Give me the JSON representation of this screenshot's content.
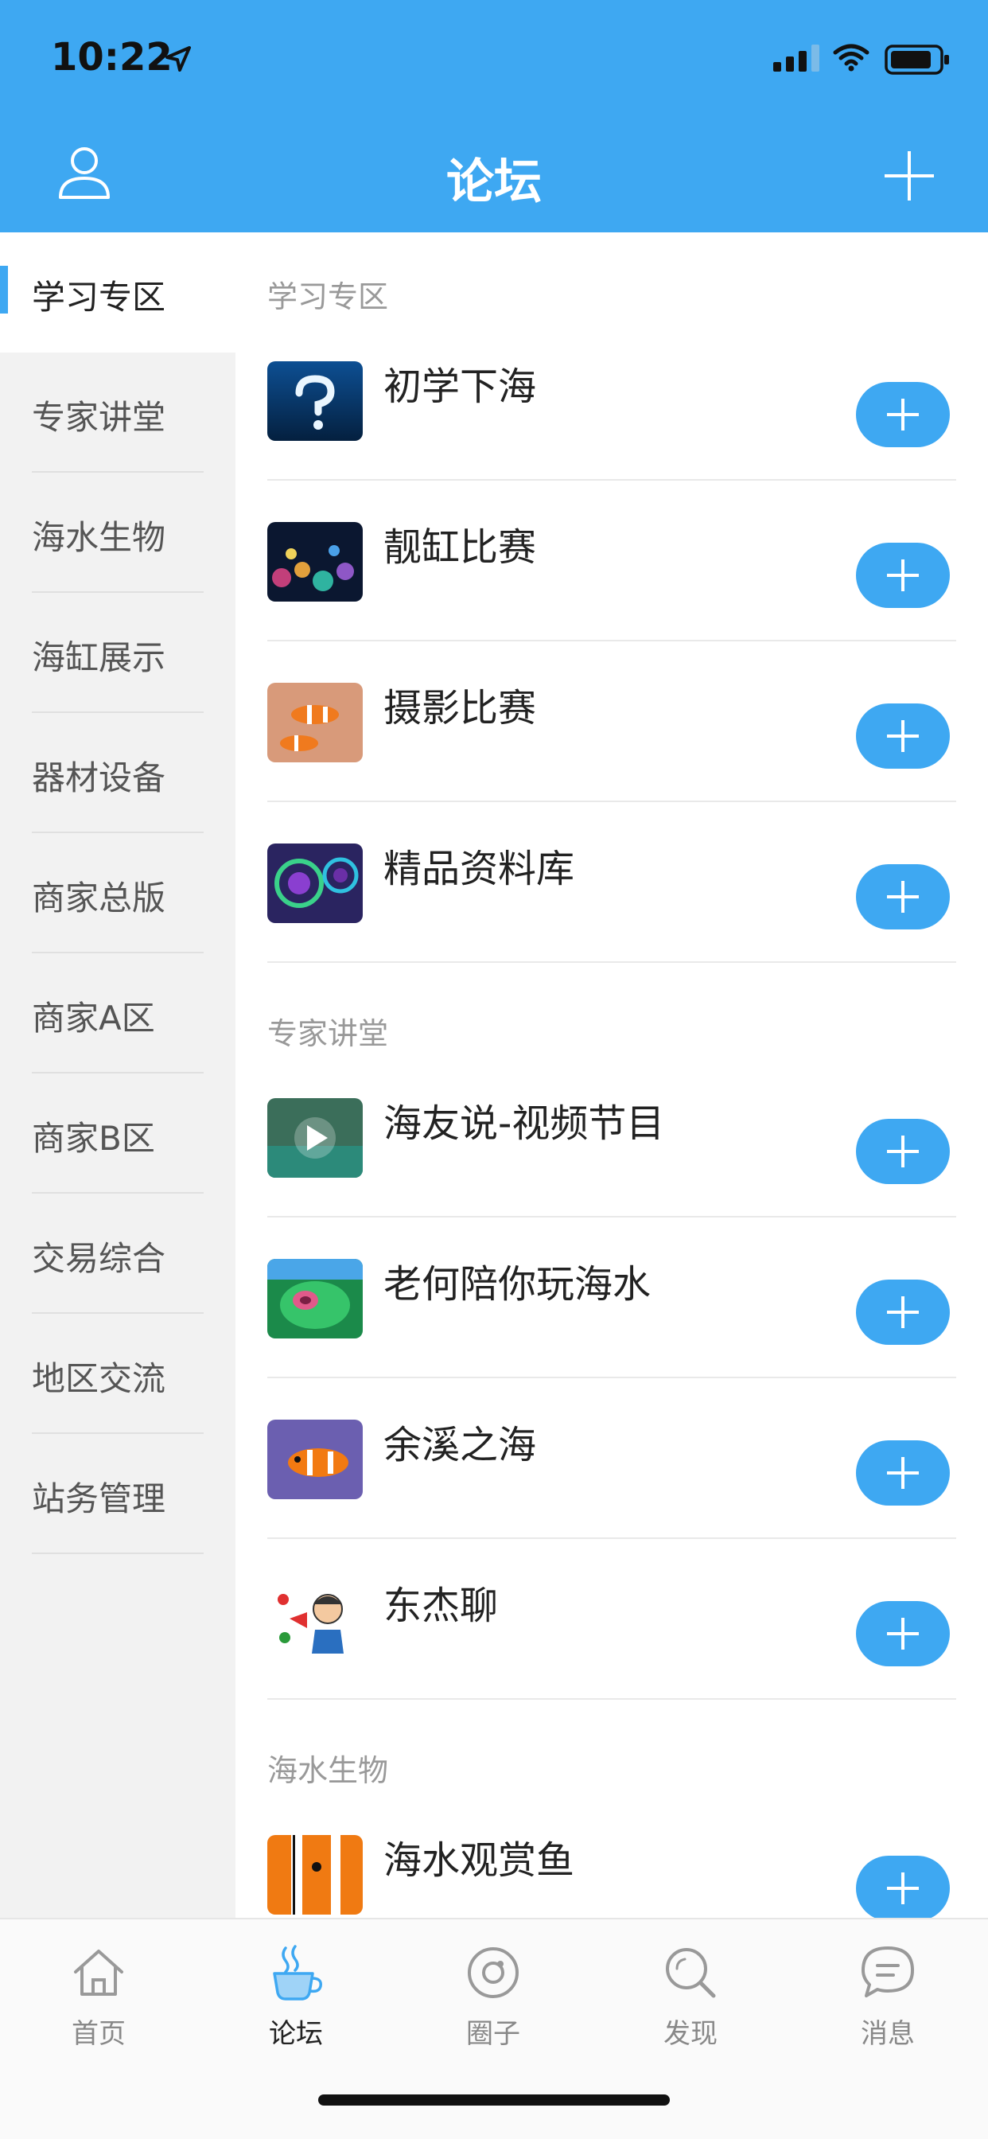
{
  "status_bar": {
    "time": "10:22"
  },
  "header": {
    "title": "论坛"
  },
  "sidebar": {
    "items": [
      {
        "label": "学习专区",
        "active": true
      },
      {
        "label": "专家讲堂",
        "active": false
      },
      {
        "label": "海水生物",
        "active": false
      },
      {
        "label": "海缸展示",
        "active": false
      },
      {
        "label": "器材设备",
        "active": false
      },
      {
        "label": "商家总版",
        "active": false
      },
      {
        "label": "商家A区",
        "active": false
      },
      {
        "label": "商家B区",
        "active": false
      },
      {
        "label": "交易综合",
        "active": false
      },
      {
        "label": "地区交流",
        "active": false
      },
      {
        "label": "站务管理",
        "active": false
      }
    ]
  },
  "content": {
    "sections": [
      {
        "title": "学习专区",
        "forums": [
          {
            "name": "初学下海",
            "thumb": "underwater-question-image"
          },
          {
            "name": "靓缸比赛",
            "thumb": "reef-tank-image"
          },
          {
            "name": "摄影比赛",
            "thumb": "clownfish-anemone-image"
          },
          {
            "name": "精品资料库",
            "thumb": "coral-closeup-image"
          }
        ]
      },
      {
        "title": "专家讲堂",
        "forums": [
          {
            "name": "海友说-视频节目",
            "thumb": "video-play-image"
          },
          {
            "name": "老何陪你玩海水",
            "thumb": "green-coral-image"
          },
          {
            "name": "余溪之海",
            "thumb": "clownfish-image"
          },
          {
            "name": "东杰聊",
            "thumb": "cartoon-avatar-image"
          }
        ]
      },
      {
        "title": "海水生物",
        "forums": [
          {
            "name": "海水观赏鱼",
            "thumb": "clownfish-closeup-image"
          }
        ]
      }
    ]
  },
  "tabbar": {
    "tabs": [
      {
        "label": "首页",
        "icon": "home-icon",
        "active": false
      },
      {
        "label": "论坛",
        "icon": "coffee-cup-icon",
        "active": true
      },
      {
        "label": "圈子",
        "icon": "circle-icon",
        "active": false
      },
      {
        "label": "发现",
        "icon": "search-icon",
        "active": false
      },
      {
        "label": "消息",
        "icon": "chat-bubble-icon",
        "active": false
      }
    ]
  },
  "colors": {
    "accent": "#3ea8f2",
    "sidebar_bg": "#f2f2f2",
    "divider": "#e9e9e9"
  }
}
